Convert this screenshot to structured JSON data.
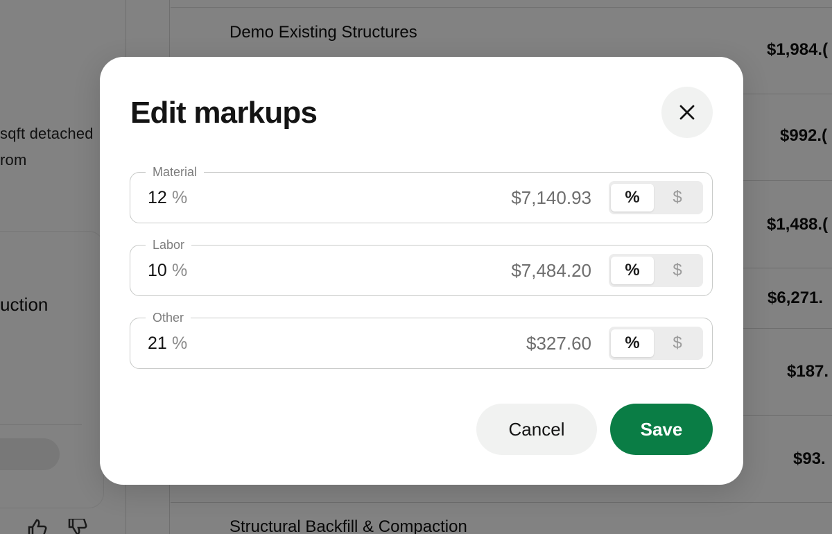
{
  "background": {
    "left_panel": {
      "line1": "sqft detached",
      "line2": "rom",
      "heading": "uction"
    },
    "rows": [
      {
        "title": "Demo Existing Structures",
        "price": "$1,984.("
      },
      {
        "title": "",
        "price": "$992.("
      },
      {
        "title": "",
        "price": "$1,488.("
      },
      {
        "title": "",
        "price": "$6,271."
      },
      {
        "title": "",
        "price": "$187."
      },
      {
        "title": "",
        "price": "$93."
      },
      {
        "title": "Structural Backfill & Compaction",
        "price": ""
      }
    ]
  },
  "modal": {
    "title": "Edit markups",
    "close_icon": "close-icon",
    "fields": [
      {
        "label": "Material",
        "value": "12",
        "unit": "%",
        "amount": "$7,140.93",
        "toggle": {
          "percent": "%",
          "dollar": "$",
          "selected": "percent"
        }
      },
      {
        "label": "Labor",
        "value": "10",
        "unit": "%",
        "amount": "$7,484.20",
        "toggle": {
          "percent": "%",
          "dollar": "$",
          "selected": "percent"
        }
      },
      {
        "label": "Other",
        "value": "21",
        "unit": "%",
        "amount": "$327.60",
        "toggle": {
          "percent": "%",
          "dollar": "$",
          "selected": "percent"
        }
      }
    ],
    "cancel_label": "Cancel",
    "save_label": "Save"
  },
  "colors": {
    "save_button": "#0a7d45",
    "overlay": "rgba(0,0,0,0.49)"
  }
}
